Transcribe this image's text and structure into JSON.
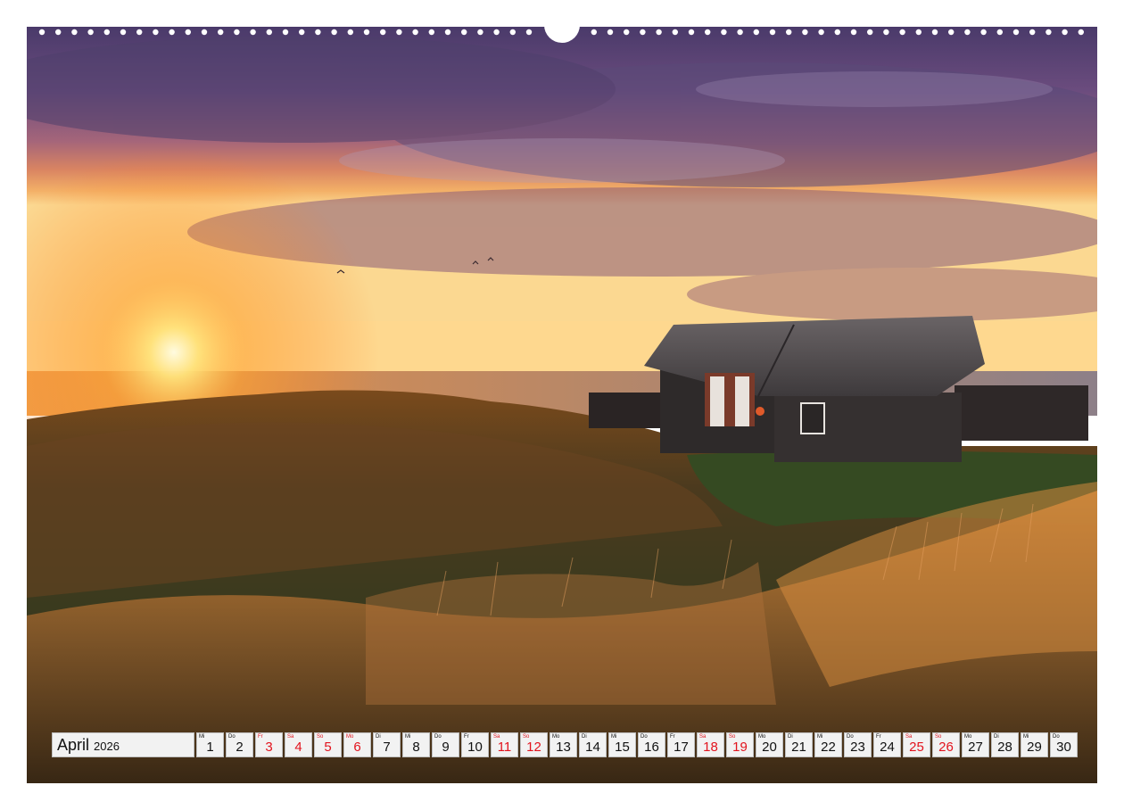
{
  "calendar": {
    "month": "April",
    "year": "2026",
    "holiday_color": "#e2131d",
    "days": [
      {
        "wd": "Mi",
        "num": "1",
        "red": false
      },
      {
        "wd": "Do",
        "num": "2",
        "red": false
      },
      {
        "wd": "Fr",
        "num": "3",
        "red": true
      },
      {
        "wd": "Sa",
        "num": "4",
        "red": true
      },
      {
        "wd": "So",
        "num": "5",
        "red": true
      },
      {
        "wd": "Mo",
        "num": "6",
        "red": true
      },
      {
        "wd": "Di",
        "num": "7",
        "red": false
      },
      {
        "wd": "Mi",
        "num": "8",
        "red": false
      },
      {
        "wd": "Do",
        "num": "9",
        "red": false
      },
      {
        "wd": "Fr",
        "num": "10",
        "red": false
      },
      {
        "wd": "Sa",
        "num": "11",
        "red": true
      },
      {
        "wd": "So",
        "num": "12",
        "red": true
      },
      {
        "wd": "Mo",
        "num": "13",
        "red": false
      },
      {
        "wd": "Di",
        "num": "14",
        "red": false
      },
      {
        "wd": "Mi",
        "num": "15",
        "red": false
      },
      {
        "wd": "Do",
        "num": "16",
        "red": false
      },
      {
        "wd": "Fr",
        "num": "17",
        "red": false
      },
      {
        "wd": "Sa",
        "num": "18",
        "red": true
      },
      {
        "wd": "So",
        "num": "19",
        "red": true
      },
      {
        "wd": "Mo",
        "num": "20",
        "red": false
      },
      {
        "wd": "Di",
        "num": "21",
        "red": false
      },
      {
        "wd": "Mi",
        "num": "22",
        "red": false
      },
      {
        "wd": "Do",
        "num": "23",
        "red": false
      },
      {
        "wd": "Fr",
        "num": "24",
        "red": false
      },
      {
        "wd": "Sa",
        "num": "25",
        "red": true
      },
      {
        "wd": "So",
        "num": "26",
        "red": true
      },
      {
        "wd": "Mo",
        "num": "27",
        "red": false
      },
      {
        "wd": "Di",
        "num": "28",
        "red": false
      },
      {
        "wd": "Mi",
        "num": "29",
        "red": false
      },
      {
        "wd": "Do",
        "num": "30",
        "red": false
      }
    ]
  }
}
